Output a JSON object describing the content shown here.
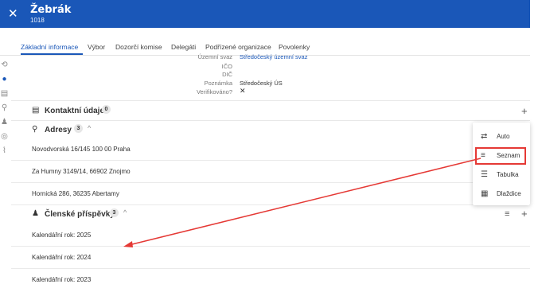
{
  "header": {
    "title": "Žebrák",
    "subtitle": "1018",
    "close_icon": "close-icon"
  },
  "tabs": [
    {
      "label": "Základní informace"
    },
    {
      "label": "Výbor"
    },
    {
      "label": "Dozorčí komise"
    },
    {
      "label": "Delegáti"
    },
    {
      "label": "Podřízené organizace"
    },
    {
      "label": "Povolenky"
    }
  ],
  "info": {
    "uzemni_svaz_label": "Územní svaz",
    "uzemni_svaz_value": "Středočeský územní svaz",
    "ico_label": "IČO",
    "dic_label": "DIČ",
    "poznamka_label": "Poznámka",
    "poznamka_value": "Středočeský ÚS",
    "verifikovano_label": "Verifikováno?",
    "verifikovano_value": "✕"
  },
  "kontaktni": {
    "title": "Kontaktní údaje",
    "count": "0"
  },
  "adresy": {
    "title": "Adresy",
    "count": "3",
    "items": [
      "Novodvorská 16/145 100 00 Praha",
      "Za Humny 3149/14, 66902 Znojmo",
      "Hornická 286, 36235 Abertamy"
    ]
  },
  "prispevky": {
    "title": "Členské příspěvky",
    "count": "3",
    "items": [
      "Kalendářní rok: 2025",
      "Kalendářní rok: 2024",
      "Kalendářní rok: 2023"
    ]
  },
  "view_menu": {
    "items": [
      {
        "label": "Auto",
        "icon": "swap-icon"
      },
      {
        "label": "Seznam",
        "icon": "list-icon"
      },
      {
        "label": "Tabulka",
        "icon": "table-icon"
      },
      {
        "label": "Dlaždice",
        "icon": "grid-icon"
      }
    ],
    "highlighted": "Seznam"
  },
  "colors": {
    "primary": "#1a57b8",
    "annotation": "#e53935"
  }
}
